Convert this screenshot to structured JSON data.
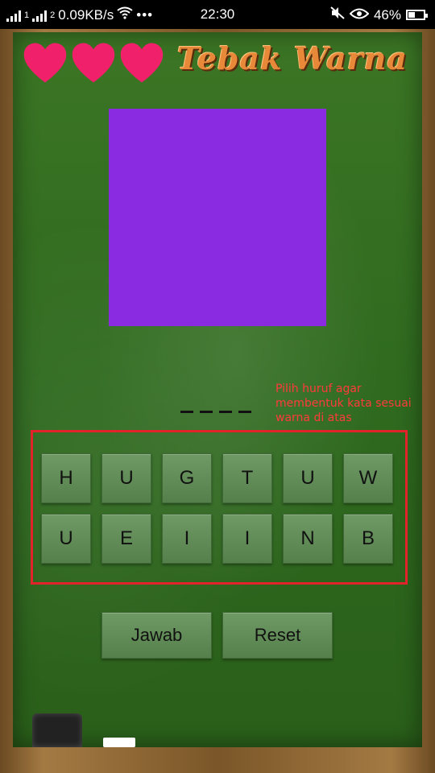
{
  "status_bar": {
    "network_speed": "0.09KB/s",
    "time": "22:30",
    "battery_percent": "46%",
    "battery_level": 0.46,
    "sim1_label": "1",
    "sim2_label": "2"
  },
  "game": {
    "title": "Tebak Warna",
    "lives": 3,
    "heart_color": "#f0206a",
    "target_color": "#8a2be2",
    "hint": "Pilih huruf agar membentuk kata sesuai warna di atas",
    "answer_slots": 4,
    "letters": [
      "H",
      "U",
      "G",
      "T",
      "U",
      "W",
      "U",
      "E",
      "I",
      "I",
      "N",
      "B"
    ],
    "answer_button": "Jawab",
    "reset_button": "Reset"
  }
}
